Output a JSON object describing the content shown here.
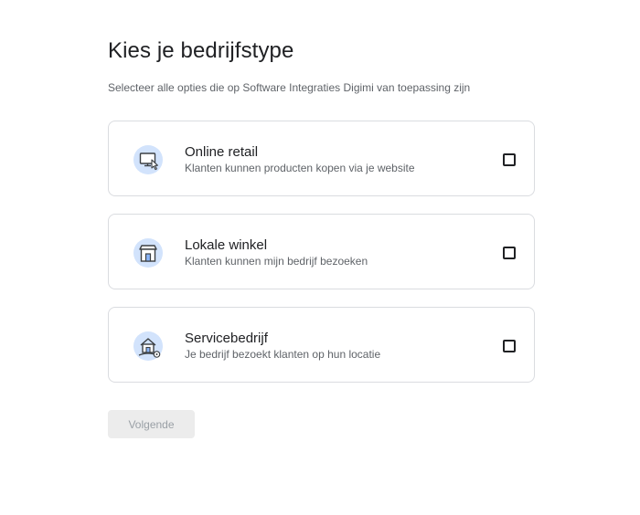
{
  "heading": "Kies je bedrijfstype",
  "subheading": "Selecteer alle opties die op Software Integraties Digimi van toepassing zijn",
  "options": [
    {
      "label": "Online retail",
      "description": "Klanten kunnen producten kopen via je website",
      "icon": "online-store-icon",
      "checked": false
    },
    {
      "label": "Lokale winkel",
      "description": "Klanten kunnen mijn bedrijf bezoeken",
      "icon": "storefront-icon",
      "checked": false
    },
    {
      "label": "Servicebedrijf",
      "description": "Je bedrijf bezoekt klanten op hun locatie",
      "icon": "house-location-icon",
      "checked": false
    }
  ],
  "next_button": {
    "label": "Volgende",
    "enabled": false
  },
  "colors": {
    "icon_bg": "#d2e3fc",
    "icon_stroke": "#3c4043",
    "border": "#dadce0",
    "button_bg": "#ececec",
    "button_text": "#9aa0a6"
  }
}
